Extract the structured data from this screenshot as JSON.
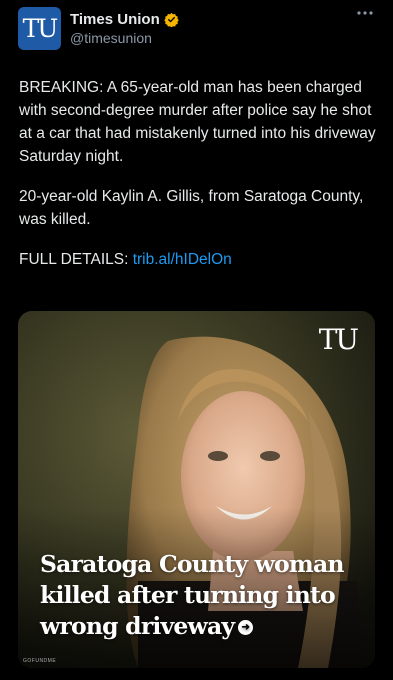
{
  "account": {
    "display_name": "Times Union",
    "handle": "@timesunion",
    "avatar_text": "TU",
    "verified_icon": "verified-badge-icon",
    "verified_color": "#f4b400",
    "avatar_color": "#1f5aa6"
  },
  "more_icon": "more-options-icon",
  "tweet": {
    "paragraph1": "BREAKING: A 65-year-old man has been charged with second-degree murder after police say he shot at a car that had mistakenly turned into his driveway Saturday night.",
    "paragraph2": "20-year-old Kaylin A. Gillis, from Saratoga County, was killed.",
    "details_label": "FULL DETAILS: ",
    "details_link": "trib.al/hIDelOn"
  },
  "media": {
    "logo_text": "TU",
    "headline": "Saratoga County woman killed after turning into wrong driveway",
    "arrow_icon": "arrow-right-circle-icon",
    "credit": "GOFUNDME"
  },
  "colors": {
    "background": "#000000",
    "text": "#e7e9ea",
    "secondary": "#8b98a5",
    "link": "#1d9bf0"
  }
}
